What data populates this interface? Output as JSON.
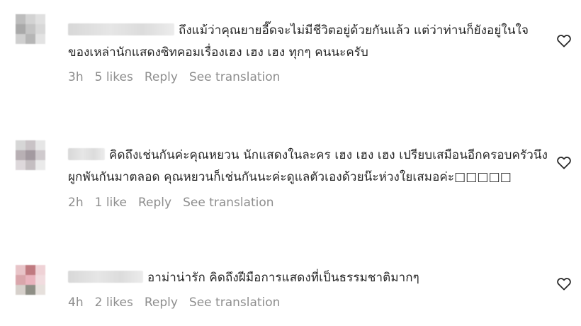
{
  "comments": [
    {
      "avatar_colors": [
        "#bdbdbd",
        "#d3d3d3",
        "#e0e0e0",
        "#a9a9a9",
        "#c4c4c4",
        "#d8d8d8",
        "#cfcfcf",
        "#b6b6b6",
        "#e3e3e3"
      ],
      "text": "ถึงแม้ว่าคุณยายอี๊ดจะไม่มีชีวิตอยู่ด้วยกันแล้ว แต่ว่าท่านก็ยังอยู่ในใจของเหล่านักแสดงซิทคอมเรื่องเฮง เฮง เฮง ทุกๆ คนนะครับ",
      "time": "3h",
      "likes": "5 likes",
      "reply": "Reply",
      "translate": "See translation"
    },
    {
      "avatar_colors": [
        "#d6d6d6",
        "#c9c3c6",
        "#e6e6e6",
        "#b8b0b4",
        "#a39aa0",
        "#cfcacd",
        "#ddd8db",
        "#c4bec1",
        "#eaeaea"
      ],
      "text": "คิดถึงเช่นกันค่ะคุณหยวน นักแสดงในละคร เฮง เฮง เฮง เปรียบเสมือนอีกครอบครัวนึง ผูกพันกันมาตลอด คุณหยวนก็เช่นกันนะค่ะดูแลตัวเองด้วยน๊ะห่วงใยเสมอค่ะ□□□□□",
      "time": "2h",
      "likes": "1 like",
      "reply": "Reply",
      "translate": "See translation"
    },
    {
      "avatar_colors": [
        "#e8c4c8",
        "#c07a80",
        "#efd2d6",
        "#d9a6ab",
        "#e9b3bd",
        "#f1dcdf",
        "#d6d0cb",
        "#8f8f86",
        "#e6e0dc"
      ],
      "text": "อาม่าน่ารัก คิดถึงฝีมือการแสดงที่เป็นธรรมชาติมากๆ",
      "time": "4h",
      "likes": "2 likes",
      "reply": "Reply",
      "translate": "See translation"
    }
  ]
}
